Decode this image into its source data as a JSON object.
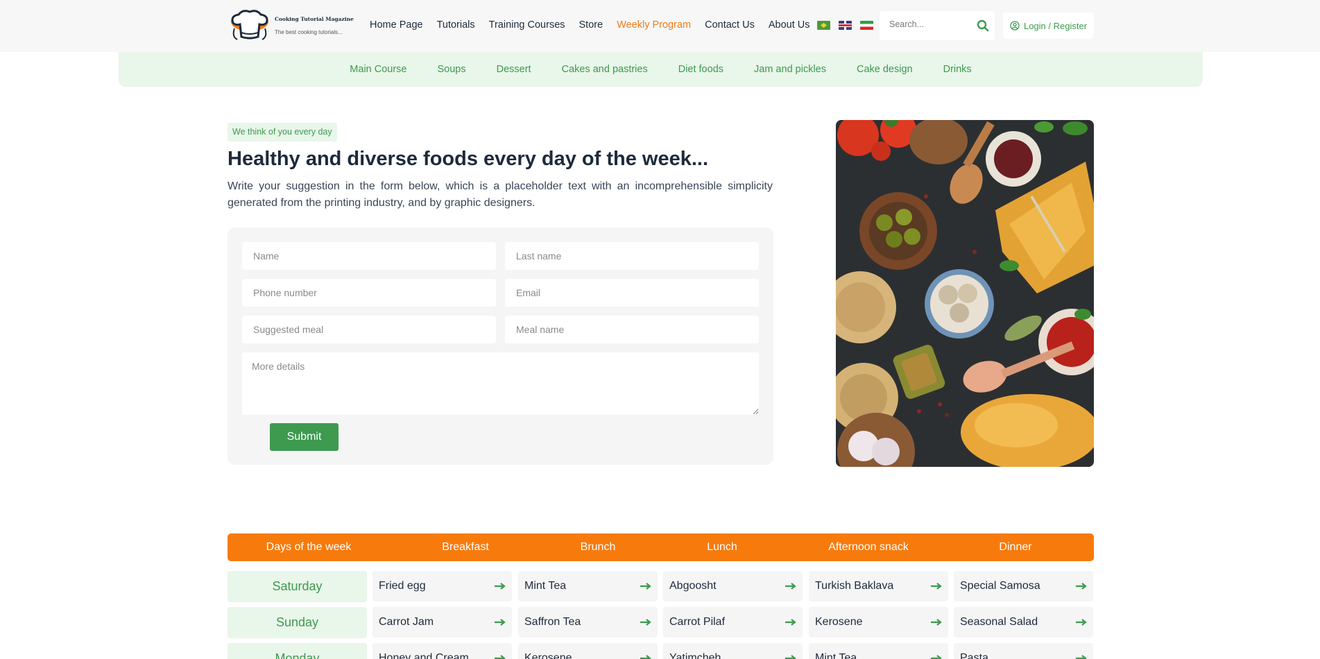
{
  "header": {
    "logo": {
      "title": "Cooking Tutorial Magazine",
      "subtitle": "The best cooking tutorials..."
    },
    "nav": [
      {
        "label": "Home Page",
        "active": false
      },
      {
        "label": "Tutorials",
        "active": false
      },
      {
        "label": "Training Courses",
        "active": false
      },
      {
        "label": "Store",
        "active": false
      },
      {
        "label": "Weekly Program",
        "active": true
      },
      {
        "label": "Contact Us",
        "active": false
      },
      {
        "label": "About Us",
        "active": false
      }
    ],
    "languages": [
      "brazil-flag-icon",
      "uk-flag-icon",
      "iran-flag-icon"
    ],
    "search": {
      "placeholder": "Search...",
      "value": ""
    },
    "login_label": "Login / Register"
  },
  "categories": [
    "Main Course",
    "Soups",
    "Dessert",
    "Cakes and pastries",
    "Diet foods",
    "Jam and pickles",
    "Cake design",
    "Drinks"
  ],
  "hero": {
    "tagline": "We think of you every day",
    "title": "Healthy and diverse foods every day of the week...",
    "description": "Write your suggestion in the form below, which is a placeholder text with an incomprehensible simplicity generated from the printing industry, and by graphic designers."
  },
  "form": {
    "name_placeholder": "Name",
    "lastname_placeholder": "Last name",
    "phone_placeholder": "Phone number",
    "email_placeholder": "Email",
    "suggested_meal_placeholder": "Suggested meal",
    "meal_name_placeholder": "Meal name",
    "details_placeholder": "More details",
    "submit_label": "Submit"
  },
  "schedule": {
    "headers": [
      "Days of the week",
      "Breakfast",
      "Brunch",
      "Lunch",
      "Afternoon snack",
      "Dinner"
    ],
    "rows": [
      {
        "day": "Saturday",
        "meals": [
          "Fried egg",
          "Mint Tea",
          "Abgoosht",
          "Turkish Baklava",
          "Special Samosa"
        ]
      },
      {
        "day": "Sunday",
        "meals": [
          "Carrot Jam",
          "Saffron Tea",
          "Carrot Pilaf",
          "Kerosene",
          "Seasonal Salad"
        ]
      },
      {
        "day": "Monday",
        "meals": [
          "Honey and Cream",
          "Kerosene",
          "Yatimcheh",
          "Mint Tea",
          "Pasta"
        ]
      }
    ]
  },
  "colors": {
    "accent_green": "#3d9a4f",
    "accent_orange": "#f77b0c",
    "active_nav": "#f07c1b",
    "light_green_bg": "#e9f6ea",
    "text_dark": "#1e2a3b"
  }
}
